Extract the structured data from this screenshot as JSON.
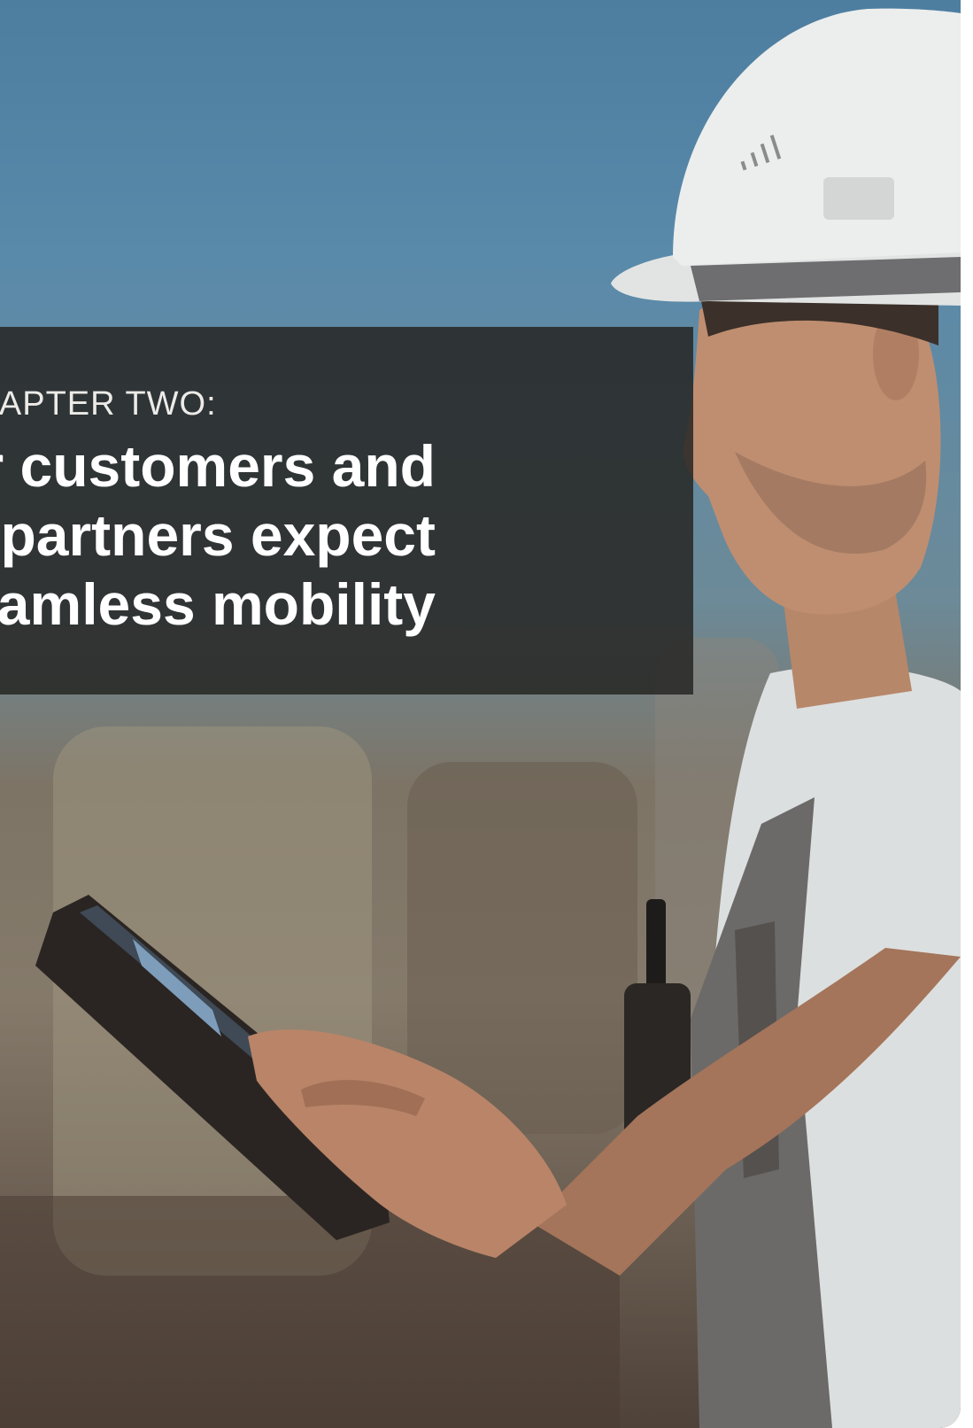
{
  "section": {
    "eyebrow": "CHAPTER TWO:",
    "headline_lines": [
      "Your customers and",
      "partners expect",
      "seamless mobility"
    ]
  },
  "photo": {
    "subject": "construction-worker-with-tablet",
    "colors": {
      "sky": "#5a8aaa",
      "helmet": "#e9ebea",
      "skin": "#b7876a",
      "shirt": "#dcdfdf",
      "overalls": "#6c6a68",
      "tablet": "#2a2522"
    }
  },
  "overlay_color": "#262624"
}
